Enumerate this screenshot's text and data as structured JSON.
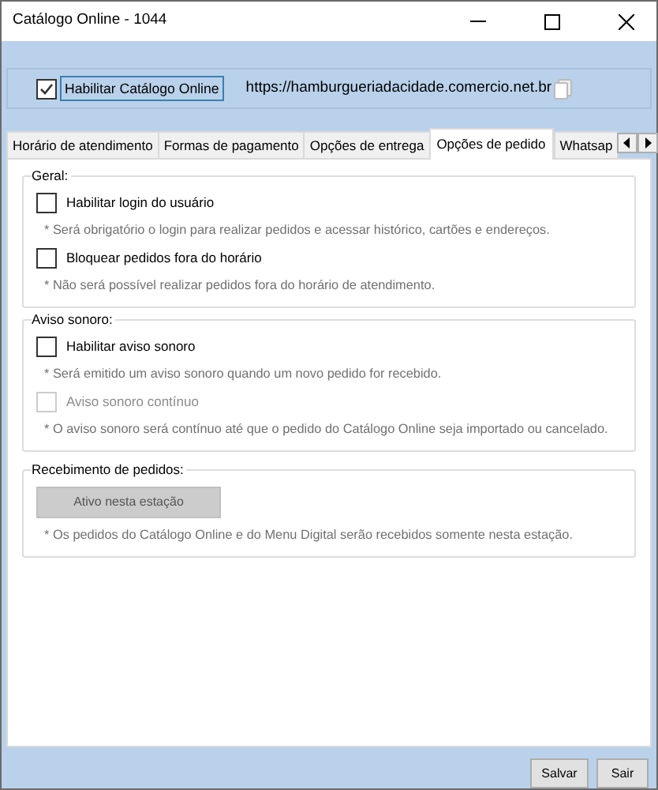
{
  "window": {
    "title": "Catálogo Online - 1044"
  },
  "header": {
    "enable": {
      "label": "Habilitar Catálogo Online",
      "checked": true
    },
    "url": "https://hamburgueriadacidade.comercio.net.br"
  },
  "tabs": [
    {
      "label": "Horário de atendimento",
      "selected": false
    },
    {
      "label": "Formas de pagamento",
      "selected": false
    },
    {
      "label": "Opções de entrega",
      "selected": false
    },
    {
      "label": "Opções de pedido",
      "selected": true
    },
    {
      "label": "Whatsap",
      "selected": false
    }
  ],
  "groups": [
    {
      "title": "Geral:",
      "items": [
        {
          "kind": "checkbox",
          "label": "Habilitar login do usuário",
          "checked": false,
          "disabled": false
        },
        {
          "kind": "note",
          "text": "* Será obrigatório o login para realizar pedidos e acessar histórico, cartões e endereços."
        },
        {
          "kind": "checkbox",
          "label": "Bloquear pedidos fora do horário",
          "checked": false,
          "disabled": false
        },
        {
          "kind": "note",
          "text": "* Não será possível realizar pedidos fora do horário de atendimento."
        }
      ]
    },
    {
      "title": "Aviso sonoro:",
      "items": [
        {
          "kind": "checkbox",
          "label": "Habilitar aviso sonoro",
          "checked": false,
          "disabled": false
        },
        {
          "kind": "note",
          "text": "* Será emitido um aviso sonoro quando um novo pedido for recebido."
        },
        {
          "kind": "checkbox",
          "label": "Aviso sonoro contínuo",
          "checked": false,
          "disabled": true
        },
        {
          "kind": "note",
          "text": "* O aviso sonoro será contínuo até que o pedido do Catálogo Online seja importado ou cancelado."
        }
      ]
    },
    {
      "title": "Recebimento de pedidos:",
      "items": [
        {
          "kind": "button",
          "label": "Ativo nesta estação",
          "disabled": true
        },
        {
          "kind": "note",
          "text": "* Os pedidos do Catálogo Online e do Menu Digital serão recebidos somente nesta estação."
        }
      ]
    }
  ],
  "buttons": [
    "Salvar",
    "Sair"
  ]
}
